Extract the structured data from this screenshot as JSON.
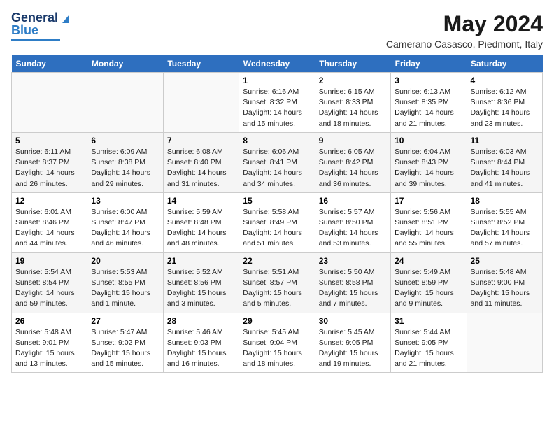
{
  "logo": {
    "line1": "General",
    "line2": "Blue"
  },
  "title": "May 2024",
  "location": "Camerano Casasco, Piedmont, Italy",
  "days_of_week": [
    "Sunday",
    "Monday",
    "Tuesday",
    "Wednesday",
    "Thursday",
    "Friday",
    "Saturday"
  ],
  "weeks": [
    [
      {
        "num": "",
        "info": ""
      },
      {
        "num": "",
        "info": ""
      },
      {
        "num": "",
        "info": ""
      },
      {
        "num": "1",
        "info": "Sunrise: 6:16 AM\nSunset: 8:32 PM\nDaylight: 14 hours\nand 15 minutes."
      },
      {
        "num": "2",
        "info": "Sunrise: 6:15 AM\nSunset: 8:33 PM\nDaylight: 14 hours\nand 18 minutes."
      },
      {
        "num": "3",
        "info": "Sunrise: 6:13 AM\nSunset: 8:35 PM\nDaylight: 14 hours\nand 21 minutes."
      },
      {
        "num": "4",
        "info": "Sunrise: 6:12 AM\nSunset: 8:36 PM\nDaylight: 14 hours\nand 23 minutes."
      }
    ],
    [
      {
        "num": "5",
        "info": "Sunrise: 6:11 AM\nSunset: 8:37 PM\nDaylight: 14 hours\nand 26 minutes."
      },
      {
        "num": "6",
        "info": "Sunrise: 6:09 AM\nSunset: 8:38 PM\nDaylight: 14 hours\nand 29 minutes."
      },
      {
        "num": "7",
        "info": "Sunrise: 6:08 AM\nSunset: 8:40 PM\nDaylight: 14 hours\nand 31 minutes."
      },
      {
        "num": "8",
        "info": "Sunrise: 6:06 AM\nSunset: 8:41 PM\nDaylight: 14 hours\nand 34 minutes."
      },
      {
        "num": "9",
        "info": "Sunrise: 6:05 AM\nSunset: 8:42 PM\nDaylight: 14 hours\nand 36 minutes."
      },
      {
        "num": "10",
        "info": "Sunrise: 6:04 AM\nSunset: 8:43 PM\nDaylight: 14 hours\nand 39 minutes."
      },
      {
        "num": "11",
        "info": "Sunrise: 6:03 AM\nSunset: 8:44 PM\nDaylight: 14 hours\nand 41 minutes."
      }
    ],
    [
      {
        "num": "12",
        "info": "Sunrise: 6:01 AM\nSunset: 8:46 PM\nDaylight: 14 hours\nand 44 minutes."
      },
      {
        "num": "13",
        "info": "Sunrise: 6:00 AM\nSunset: 8:47 PM\nDaylight: 14 hours\nand 46 minutes."
      },
      {
        "num": "14",
        "info": "Sunrise: 5:59 AM\nSunset: 8:48 PM\nDaylight: 14 hours\nand 48 minutes."
      },
      {
        "num": "15",
        "info": "Sunrise: 5:58 AM\nSunset: 8:49 PM\nDaylight: 14 hours\nand 51 minutes."
      },
      {
        "num": "16",
        "info": "Sunrise: 5:57 AM\nSunset: 8:50 PM\nDaylight: 14 hours\nand 53 minutes."
      },
      {
        "num": "17",
        "info": "Sunrise: 5:56 AM\nSunset: 8:51 PM\nDaylight: 14 hours\nand 55 minutes."
      },
      {
        "num": "18",
        "info": "Sunrise: 5:55 AM\nSunset: 8:52 PM\nDaylight: 14 hours\nand 57 minutes."
      }
    ],
    [
      {
        "num": "19",
        "info": "Sunrise: 5:54 AM\nSunset: 8:54 PM\nDaylight: 14 hours\nand 59 minutes."
      },
      {
        "num": "20",
        "info": "Sunrise: 5:53 AM\nSunset: 8:55 PM\nDaylight: 15 hours\nand 1 minute."
      },
      {
        "num": "21",
        "info": "Sunrise: 5:52 AM\nSunset: 8:56 PM\nDaylight: 15 hours\nand 3 minutes."
      },
      {
        "num": "22",
        "info": "Sunrise: 5:51 AM\nSunset: 8:57 PM\nDaylight: 15 hours\nand 5 minutes."
      },
      {
        "num": "23",
        "info": "Sunrise: 5:50 AM\nSunset: 8:58 PM\nDaylight: 15 hours\nand 7 minutes."
      },
      {
        "num": "24",
        "info": "Sunrise: 5:49 AM\nSunset: 8:59 PM\nDaylight: 15 hours\nand 9 minutes."
      },
      {
        "num": "25",
        "info": "Sunrise: 5:48 AM\nSunset: 9:00 PM\nDaylight: 15 hours\nand 11 minutes."
      }
    ],
    [
      {
        "num": "26",
        "info": "Sunrise: 5:48 AM\nSunset: 9:01 PM\nDaylight: 15 hours\nand 13 minutes."
      },
      {
        "num": "27",
        "info": "Sunrise: 5:47 AM\nSunset: 9:02 PM\nDaylight: 15 hours\nand 15 minutes."
      },
      {
        "num": "28",
        "info": "Sunrise: 5:46 AM\nSunset: 9:03 PM\nDaylight: 15 hours\nand 16 minutes."
      },
      {
        "num": "29",
        "info": "Sunrise: 5:45 AM\nSunset: 9:04 PM\nDaylight: 15 hours\nand 18 minutes."
      },
      {
        "num": "30",
        "info": "Sunrise: 5:45 AM\nSunset: 9:05 PM\nDaylight: 15 hours\nand 19 minutes."
      },
      {
        "num": "31",
        "info": "Sunrise: 5:44 AM\nSunset: 9:05 PM\nDaylight: 15 hours\nand 21 minutes."
      },
      {
        "num": "",
        "info": ""
      }
    ]
  ]
}
